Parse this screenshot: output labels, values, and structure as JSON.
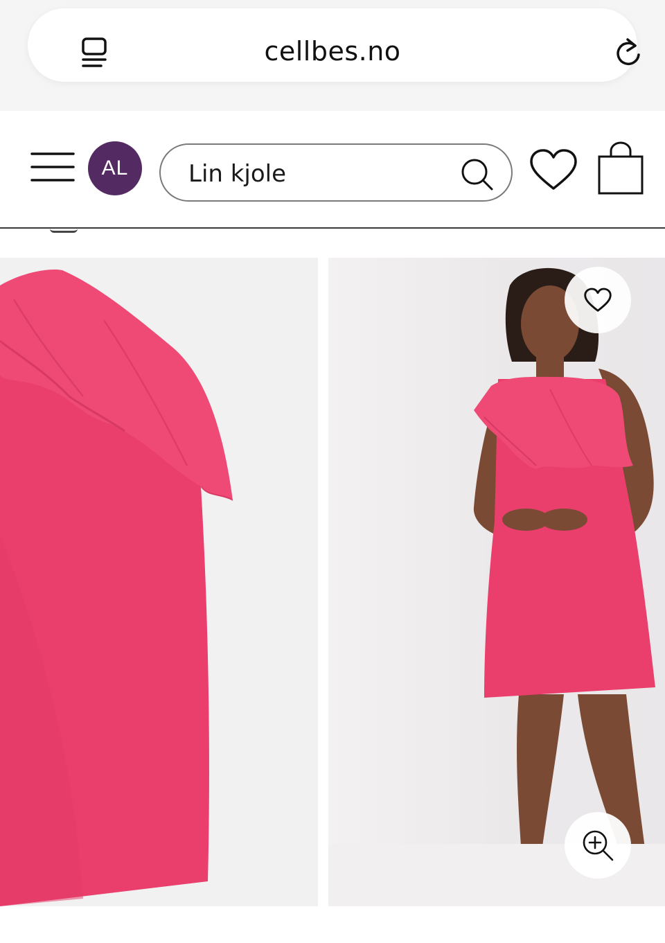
{
  "browser": {
    "url": "cellbes.no",
    "tabs_icon": "tabs-icon",
    "reload_icon": "reload-icon"
  },
  "header": {
    "menu_icon": "hamburger-icon",
    "avatar_initials": "AL",
    "search": {
      "value": "Lin kjole",
      "icon": "search-icon"
    },
    "wishlist_icon": "heart-icon",
    "cart_icon": "bag-icon"
  },
  "product": {
    "image_count": 2,
    "favorite_icon": "heart-icon",
    "zoom_icon": "zoom-in-icon"
  },
  "colors": {
    "avatar_bg": "#542a63",
    "dress_pink": "#ea3f6c",
    "image_bg": "#f2f1f2"
  }
}
